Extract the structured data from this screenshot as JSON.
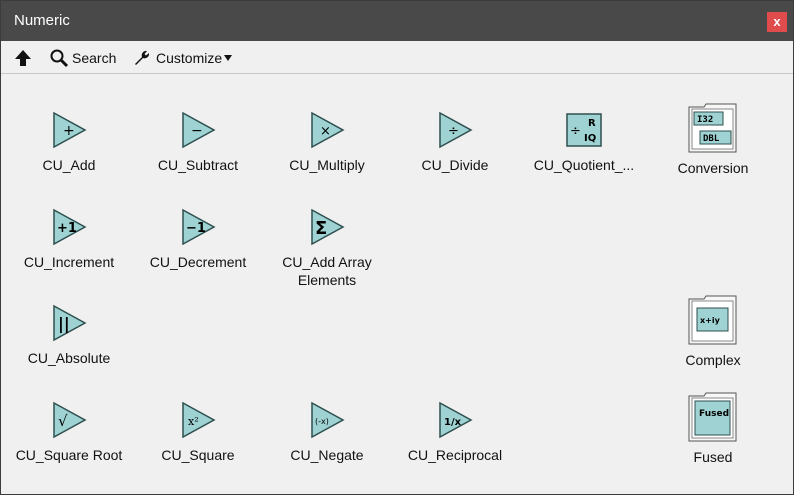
{
  "window": {
    "title": "Numeric",
    "close_label": "x"
  },
  "toolbar": {
    "search_label": "Search",
    "customize_label": "Customize"
  },
  "palette": {
    "items": [
      {
        "label": "CU_Add",
        "glyph": "+"
      },
      {
        "label": "CU_Subtract",
        "glyph": "−"
      },
      {
        "label": "CU_Multiply",
        "glyph": "×"
      },
      {
        "label": "CU_Divide",
        "glyph": "÷"
      },
      {
        "label": "CU_Quotient_...",
        "glyph_r": "R",
        "glyph_iq": "IQ",
        "glyph_div": "÷"
      },
      {
        "label": "Conversion",
        "glyph_top": "I32",
        "glyph_bottom": "DBL"
      },
      {
        "label": "CU_Increment",
        "glyph": "+1"
      },
      {
        "label": "CU_Decrement",
        "glyph": "−1"
      },
      {
        "label": "CU_Add Array Elements",
        "glyph": "Σ"
      },
      {
        "label": "CU_Absolute",
        "glyph": "||"
      },
      {
        "label": "Complex",
        "glyph": "x+iy"
      },
      {
        "label": "CU_Square Root",
        "glyph": "√"
      },
      {
        "label": "CU_Square",
        "glyph": "x²"
      },
      {
        "label": "CU_Negate",
        "glyph": "(-x)"
      },
      {
        "label": "CU_Reciprocal",
        "glyph": "1/x"
      },
      {
        "label": "Fused",
        "glyph": "Fused"
      }
    ]
  },
  "colors": {
    "icon_fill": "#9fd3d3",
    "icon_stroke": "#2f4f4f",
    "titlebar": "#494949",
    "close": "#e04b4b"
  }
}
